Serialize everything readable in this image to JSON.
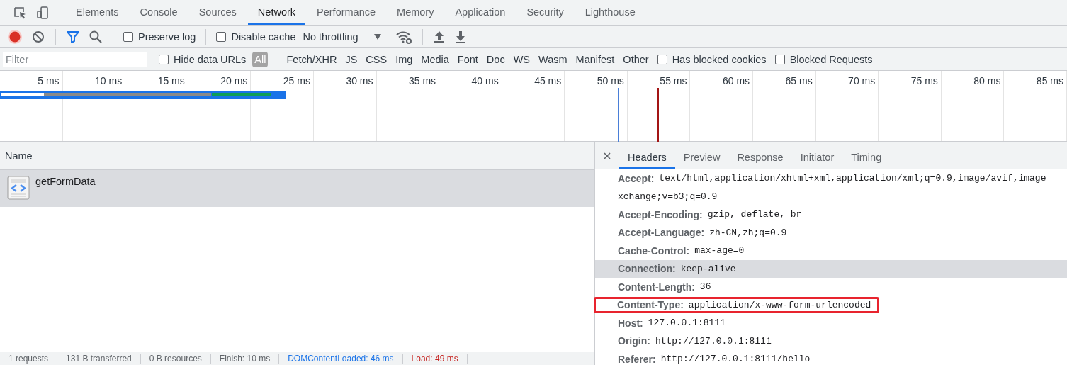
{
  "main_tabs": [
    {
      "label": "Elements",
      "selected": false
    },
    {
      "label": "Console",
      "selected": false
    },
    {
      "label": "Sources",
      "selected": false
    },
    {
      "label": "Network",
      "selected": true
    },
    {
      "label": "Performance",
      "selected": false
    },
    {
      "label": "Memory",
      "selected": false
    },
    {
      "label": "Application",
      "selected": false
    },
    {
      "label": "Security",
      "selected": false
    },
    {
      "label": "Lighthouse",
      "selected": false
    }
  ],
  "toolbar": {
    "recording": true,
    "filter_on": true,
    "checkboxes": [
      {
        "label": "Preserve log",
        "checked": false
      },
      {
        "label": "Disable cache",
        "checked": false
      }
    ],
    "throttling": "No throttling"
  },
  "filter_bar": {
    "placeholder": "Filter",
    "hide_data_urls": {
      "label": "Hide data URLs",
      "checked": false
    },
    "types": [
      {
        "label": "All",
        "selected": true
      },
      {
        "label": "Fetch/XHR",
        "selected": false
      },
      {
        "label": "JS",
        "selected": false
      },
      {
        "label": "CSS",
        "selected": false
      },
      {
        "label": "Img",
        "selected": false
      },
      {
        "label": "Media",
        "selected": false
      },
      {
        "label": "Font",
        "selected": false
      },
      {
        "label": "Doc",
        "selected": false
      },
      {
        "label": "WS",
        "selected": false
      },
      {
        "label": "Wasm",
        "selected": false
      },
      {
        "label": "Manifest",
        "selected": false
      },
      {
        "label": "Other",
        "selected": false
      }
    ],
    "extra_checkboxes": [
      {
        "label": "Has blocked cookies",
        "checked": false
      },
      {
        "label": "Blocked Requests",
        "checked": false
      }
    ]
  },
  "timeline": {
    "ticks": [
      "5 ms",
      "10 ms",
      "15 ms",
      "20 ms",
      "25 ms",
      "30 ms",
      "35 ms",
      "40 ms",
      "45 ms",
      "50 ms",
      "55 ms",
      "60 ms",
      "65 ms",
      "70 ms",
      "75 ms",
      "80 ms",
      "85 ms"
    ]
  },
  "requests": {
    "columns": [
      "Name"
    ],
    "rows": [
      {
        "name": "getFormData",
        "selected": true
      }
    ]
  },
  "details": {
    "tabs": [
      {
        "label": "Headers",
        "selected": true
      },
      {
        "label": "Preview",
        "selected": false
      },
      {
        "label": "Response",
        "selected": false
      },
      {
        "label": "Initiator",
        "selected": false
      },
      {
        "label": "Timing",
        "selected": false
      }
    ],
    "headers": [
      {
        "name": "Accept:",
        "value": "text/html,application/xhtml+xml,application/xml;q=0.9,image/avif,image",
        "highlighted": false,
        "boxed": false
      },
      {
        "value": "xchange;v=b3;q=0.9",
        "highlighted": false,
        "boxed": false
      },
      {
        "name": "Accept-Encoding:",
        "value": "gzip, deflate, br",
        "highlighted": false,
        "boxed": false
      },
      {
        "name": "Accept-Language:",
        "value": "zh-CN,zh;q=0.9",
        "highlighted": false,
        "boxed": false
      },
      {
        "name": "Cache-Control:",
        "value": "max-age=0",
        "highlighted": false,
        "boxed": false
      },
      {
        "name": "Connection:",
        "value": "keep-alive",
        "highlighted": true,
        "boxed": false
      },
      {
        "name": "Content-Length:",
        "value": "36",
        "highlighted": false,
        "boxed": false
      },
      {
        "name": "Content-Type:",
        "value": "application/x-www-form-urlencoded",
        "highlighted": false,
        "boxed": true
      },
      {
        "name": "Host:",
        "value": "127.0.0.1:8111",
        "highlighted": false,
        "boxed": false
      },
      {
        "name": "Origin:",
        "value": "http://127.0.0.1:8111",
        "highlighted": false,
        "boxed": false
      },
      {
        "name": "Referer:",
        "value": "http://127.0.0.1:8111/hello",
        "highlighted": false,
        "boxed": false
      }
    ]
  },
  "status_bar": [
    {
      "text": "1 requests",
      "color": "#5f6368"
    },
    {
      "text": "131 B transferred",
      "color": "#5f6368"
    },
    {
      "text": "0 B resources",
      "color": "#5f6368"
    },
    {
      "text": "Finish: 10 ms",
      "color": "#5f6368"
    },
    {
      "text": "DOMContentLoaded: 46 ms",
      "color": "#1a73e8"
    },
    {
      "text": "Load: 49 ms",
      "color": "#c5221f"
    }
  ]
}
